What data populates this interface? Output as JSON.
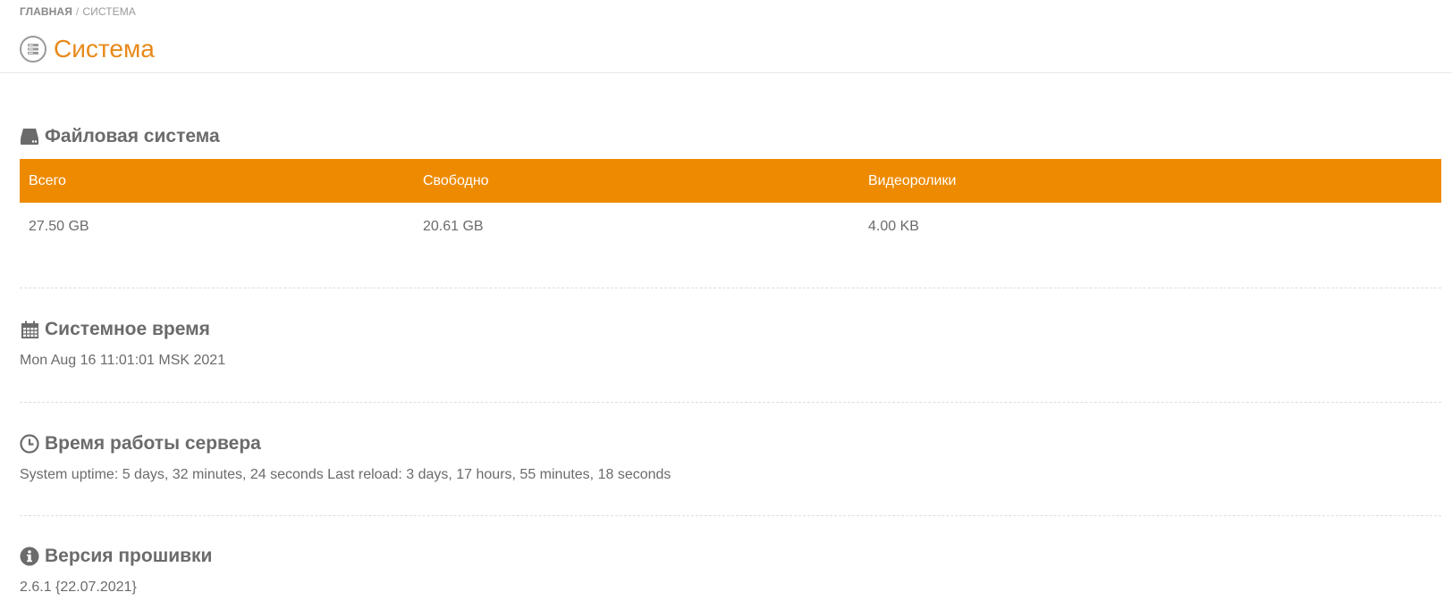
{
  "breadcrumb": {
    "home": "ГЛАВНАЯ",
    "separator": "/",
    "current": "СИСТЕМА"
  },
  "page": {
    "title": "Система",
    "icon": "server-icon",
    "accent_color": "#e8891a"
  },
  "filesystem": {
    "title": "Файловая система",
    "icon": "hard-drive-icon",
    "header_color": "#ee8a00",
    "columns": [
      "Всего",
      "Свободно",
      "Видеоролики"
    ],
    "rows": [
      [
        "27.50 GB",
        "20.61 GB",
        "4.00 KB"
      ]
    ]
  },
  "system_time": {
    "title": "Системное время",
    "icon": "calendar-icon",
    "value": "Mon Aug 16 11:01:01 MSK 2021"
  },
  "uptime": {
    "title": "Время работы сервера",
    "icon": "clock-icon",
    "value": "System uptime: 5 days, 32 minutes, 24 seconds Last reload: 3 days, 17 hours, 55 minutes, 18 seconds"
  },
  "firmware": {
    "title": "Версия прошивки",
    "icon": "info-icon",
    "value": "2.6.1 {22.07.2021}"
  }
}
